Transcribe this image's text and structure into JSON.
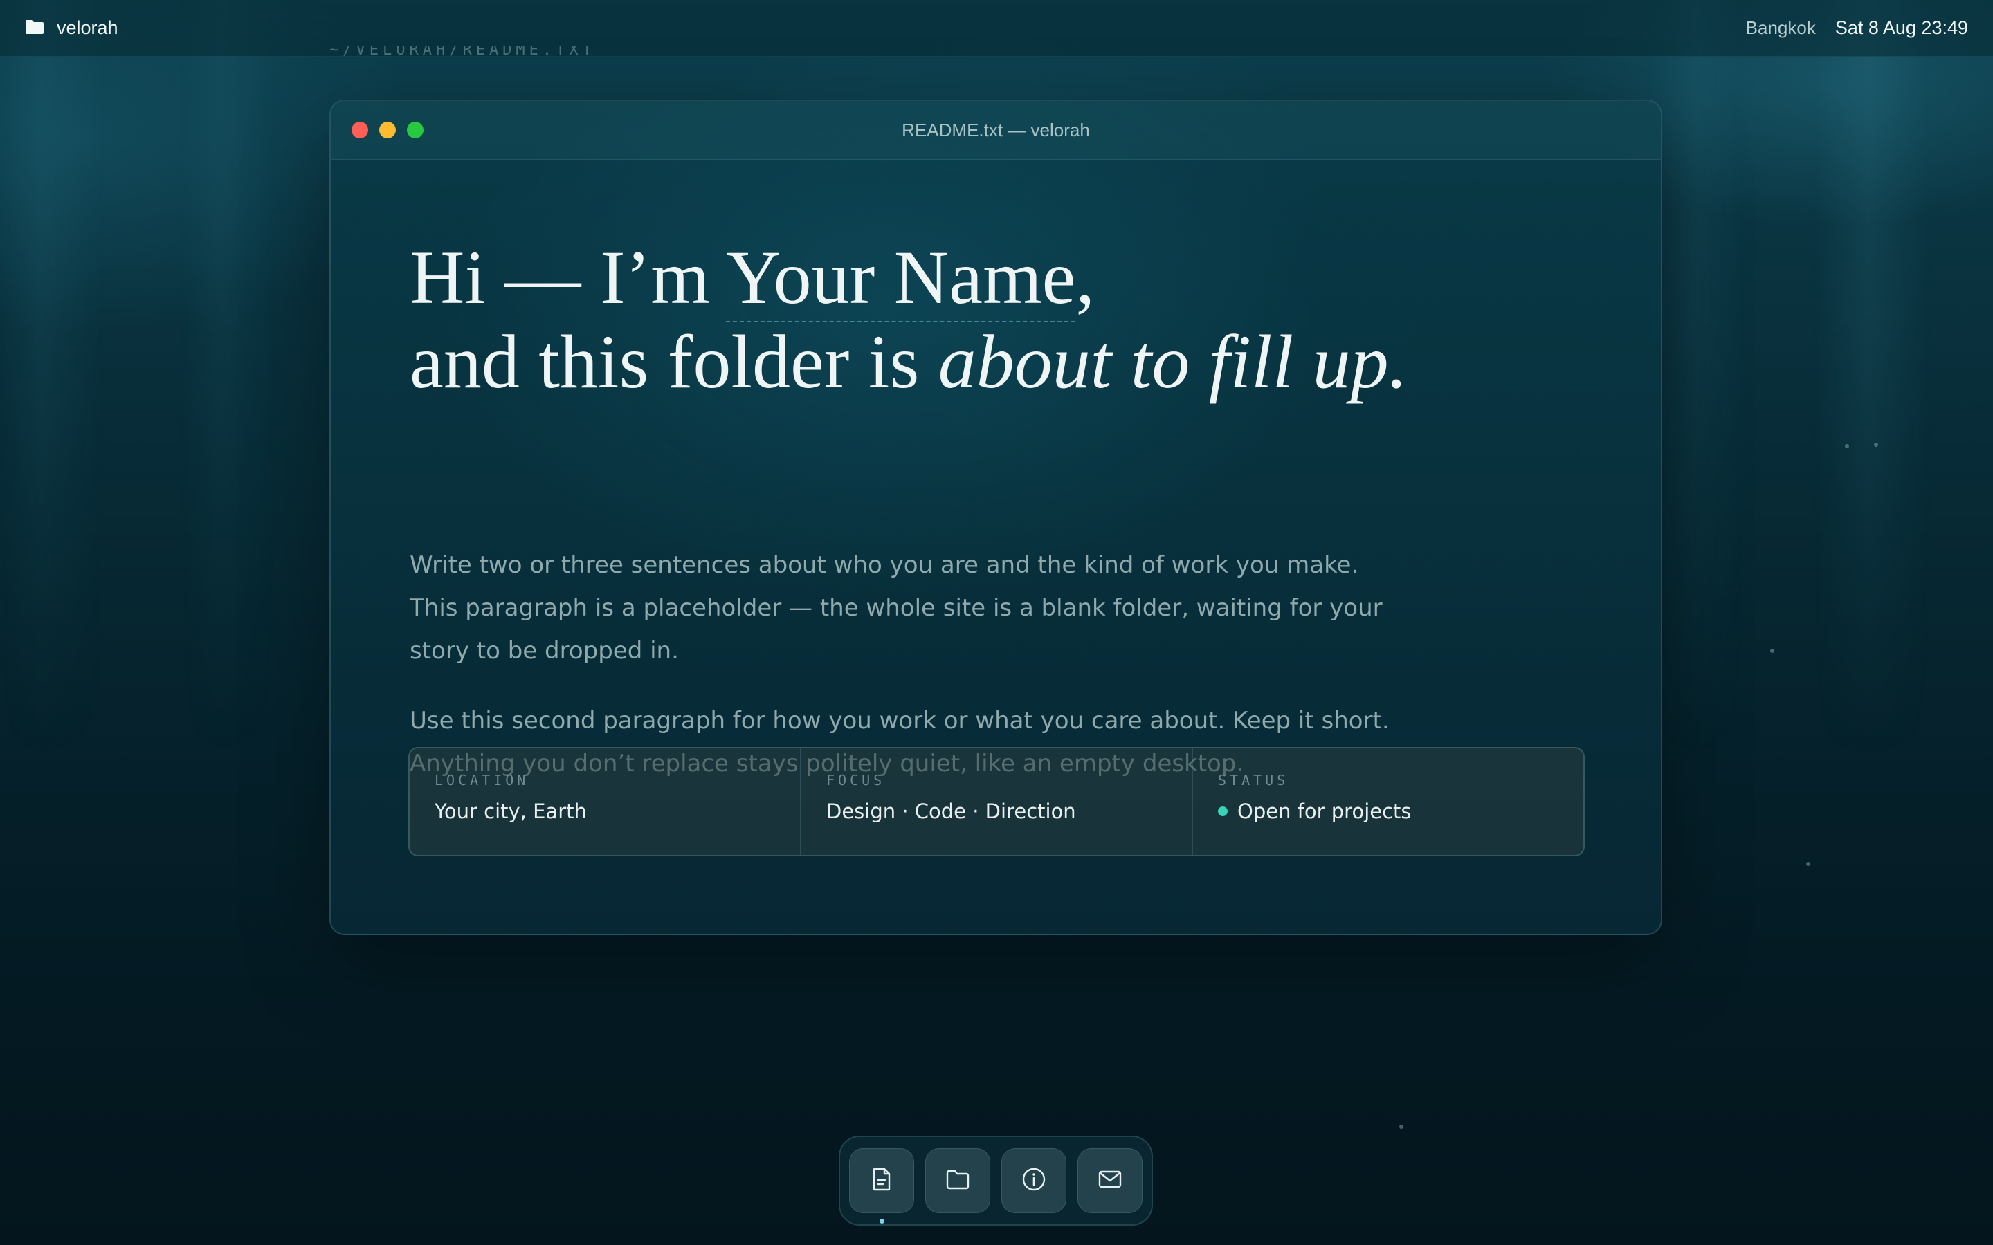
{
  "menubar": {
    "app_name": "velorah",
    "city": "Bangkok",
    "datetime": "Sat 8 Aug 23:49"
  },
  "path_ghost": "~/VELORAH/README.TXT",
  "window": {
    "title": "README.txt — velorah",
    "traffic_lights": {
      "close": "#ff5f57",
      "minimize": "#febc2e",
      "zoom": "#28c840"
    }
  },
  "headline": {
    "line1_prefix": "Hi — I’m ",
    "name": "Your Name",
    "line1_suffix": ",",
    "line2_prefix": "and this folder is ",
    "line2_emphasis": "about to fill up."
  },
  "paragraphs": [
    "Write two or three sentences about who you are and the kind of work you make. This paragraph is a placeholder — the whole site is a blank folder, waiting for your story to be dropped in.",
    "Use this second paragraph for how you work or what you care about. Keep it short. Anything you don’t replace stays politely quiet, like an empty desktop."
  ],
  "info": {
    "location": {
      "label": "LOCATION",
      "value": "Your city, Earth"
    },
    "focus": {
      "label": "FOCUS",
      "value": "Design · Code · Direction"
    },
    "status": {
      "label": "STATUS",
      "value": "Open for projects",
      "color": "#37d3b8"
    }
  },
  "dock": {
    "items": [
      {
        "icon": "document-icon",
        "active": true
      },
      {
        "icon": "folder-icon",
        "active": false
      },
      {
        "icon": "info-icon",
        "active": false
      },
      {
        "icon": "mail-icon",
        "active": false
      }
    ]
  },
  "colors": {
    "accent": "#37d3b8",
    "background_top": "#0d4150",
    "background_bottom": "#04151d"
  }
}
